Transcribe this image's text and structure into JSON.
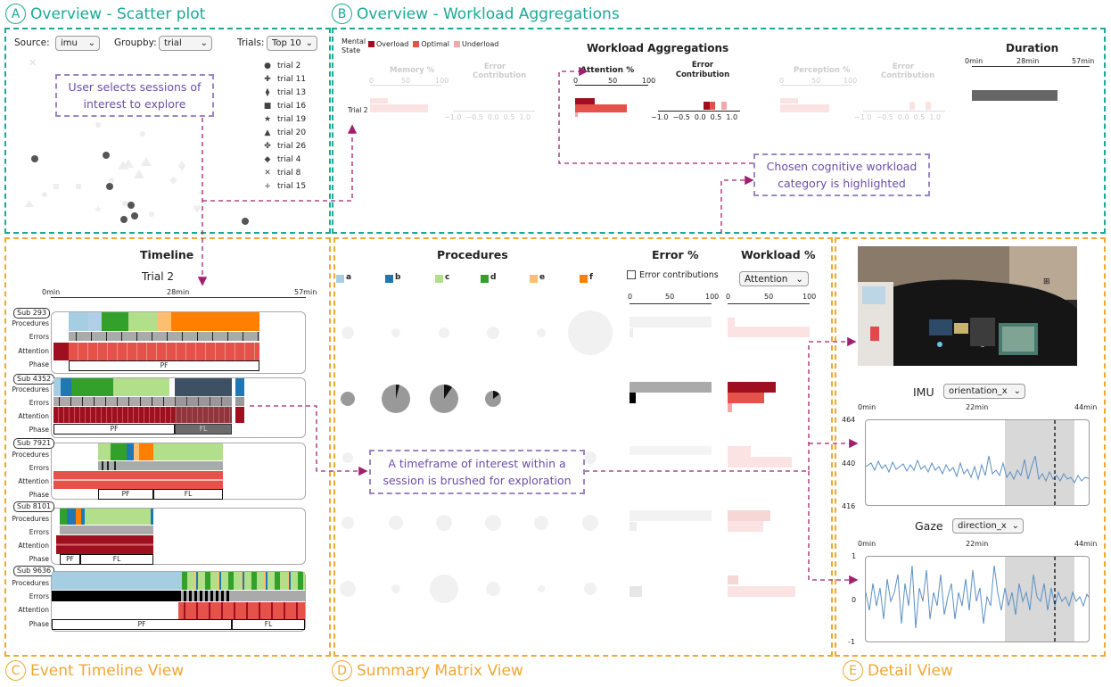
{
  "sections": {
    "a": {
      "letter": "A",
      "title": "Overview - Scatter plot"
    },
    "b": {
      "letter": "B",
      "title": "Overview - Workload Aggregations"
    },
    "c": {
      "letter": "C",
      "title": "Event Timeline View"
    },
    "d": {
      "letter": "D",
      "title": "Summary Matrix View"
    },
    "e": {
      "letter": "E",
      "title": "Detail View"
    }
  },
  "scatter": {
    "source_label": "Source:",
    "source_value": "imu",
    "groupby_label": "Groupby:",
    "groupby_value": "trial",
    "trials_label": "Trials:",
    "trials_value": "Top 10",
    "legend": [
      {
        "glyph": "●",
        "label": "trial 2"
      },
      {
        "glyph": "✚",
        "label": "trial 11"
      },
      {
        "glyph": "⧫",
        "label": "trial 13"
      },
      {
        "glyph": "■",
        "label": "trial 16"
      },
      {
        "glyph": "★",
        "label": "trial 19"
      },
      {
        "glyph": "▲",
        "label": "trial 20"
      },
      {
        "glyph": "✤",
        "label": "trial 26"
      },
      {
        "glyph": "◆",
        "label": "trial 4"
      },
      {
        "glyph": "✕",
        "label": "trial 8"
      },
      {
        "glyph": "+",
        "label": "trial 15"
      }
    ]
  },
  "callouts": {
    "select_sessions": "User selects sessions of interest to explore",
    "highlight": "Chosen cognitive workload category is highlighted",
    "brush": "A timeframe of interest within a session is brushed for exploration"
  },
  "workload": {
    "mental_state": "Mental State",
    "legend": [
      {
        "label": "Overload",
        "color": "#9e1020"
      },
      {
        "label": "Optimal",
        "color": "#e5524a"
      },
      {
        "label": "Underload",
        "color": "#f2a7a8"
      }
    ],
    "title": "Workload Aggregations",
    "duration_title": "Duration",
    "duration_ticks": [
      "0min",
      "28min",
      "57min"
    ],
    "row_label": "Trial 2",
    "panels": [
      {
        "title": "Memory %",
        "ticks": [
          "0",
          "50",
          "100"
        ],
        "faded": true
      },
      {
        "title": "Error Contribution",
        "ticks": [
          "−1.0",
          "−0.5",
          "0.0",
          "0.5",
          "1.0"
        ],
        "faded": true
      },
      {
        "title": "Attention %",
        "ticks": [
          "0",
          "50",
          "100"
        ],
        "faded": false
      },
      {
        "title": "Error Contribution",
        "ticks": [
          "−1.0",
          "−0.5",
          "0.0",
          "0.5",
          "1.0"
        ],
        "faded": false
      },
      {
        "title": "Perception %",
        "ticks": [
          "0",
          "50",
          "100"
        ],
        "faded": true
      },
      {
        "title": "Error Contribution",
        "ticks": [
          "−1.0",
          "−0.5",
          "0.0",
          "0.5",
          "1.0"
        ],
        "faded": true
      }
    ]
  },
  "timeline": {
    "title": "Timeline",
    "trial": "Trial 2",
    "ticks": [
      "0min",
      "28min",
      "57min"
    ],
    "row_labels": [
      "Procedures",
      "Errors",
      "Attention",
      "Phase"
    ],
    "subjects": [
      {
        "name": "Sub 293",
        "phases": [
          "PF"
        ]
      },
      {
        "name": "Sub 4352",
        "phases": [
          "PF",
          "FL"
        ]
      },
      {
        "name": "Sub 7921",
        "phases": [
          "PF",
          "FL"
        ]
      },
      {
        "name": "Sub 8101",
        "phases": [
          "PF",
          "FL"
        ]
      },
      {
        "name": "Sub 9636",
        "phases": [
          "PF",
          "FL"
        ]
      }
    ]
  },
  "matrix": {
    "procedures_title": "Procedures",
    "procedures": [
      {
        "key": "a",
        "color": "#a6cee3"
      },
      {
        "key": "b",
        "color": "#1f78b4"
      },
      {
        "key": "c",
        "color": "#b2df8a"
      },
      {
        "key": "d",
        "color": "#33a02c"
      },
      {
        "key": "e",
        "color": "#fdbf6f"
      },
      {
        "key": "f",
        "color": "#ff7f00"
      }
    ],
    "error_title": "Error %",
    "error_ticks": [
      "0",
      "50",
      "100"
    ],
    "error_contrib_label": "Error contributions",
    "workload_title": "Workload %",
    "workload_select": "Attention",
    "workload_ticks": [
      "0",
      "50",
      "100"
    ]
  },
  "detail": {
    "imu_title": "IMU",
    "imu_select": "orientation_x",
    "imu_xticks": [
      "0min",
      "22min",
      "44min"
    ],
    "imu_yticks": [
      "464",
      "440",
      "416"
    ],
    "gaze_title": "Gaze",
    "gaze_select": "direction_x",
    "gaze_xticks": [
      "0min",
      "22min",
      "44min"
    ],
    "gaze_yticks": [
      "1",
      "0",
      "-1"
    ]
  },
  "colors": {
    "teal": "#1ba896",
    "orange": "#f0a830",
    "callout": "#9b85c4",
    "arrow": "#a0206f",
    "line": "#5b8fc2"
  }
}
